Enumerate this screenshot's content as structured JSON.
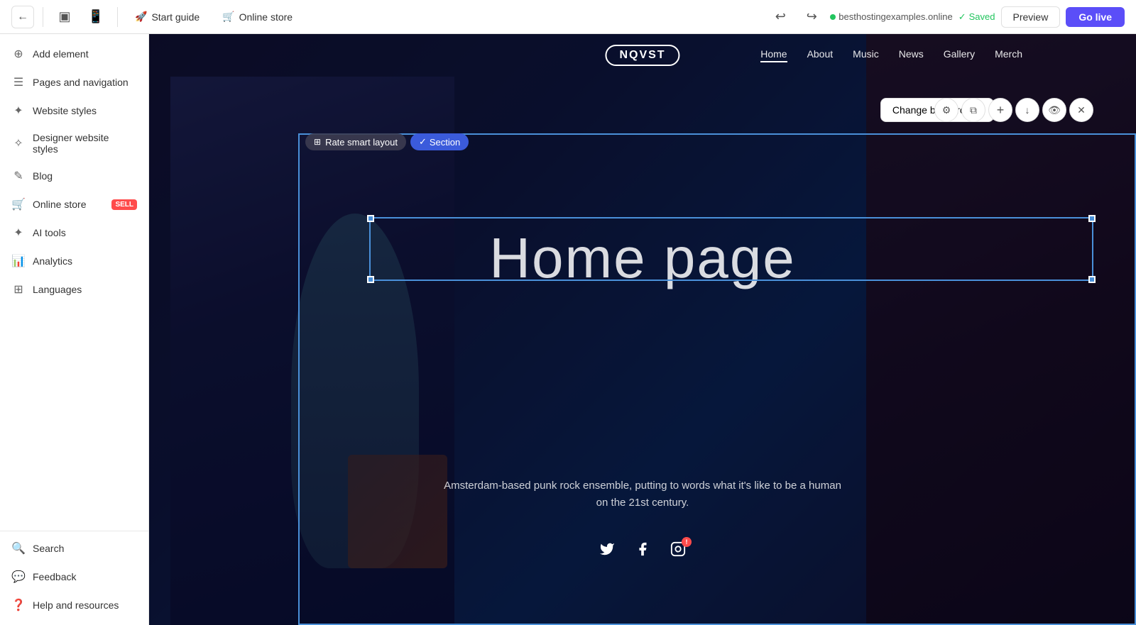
{
  "topbar": {
    "back_icon": "←",
    "desktop_icon": "⬜",
    "start_guide_label": "Start guide",
    "start_guide_icon": "🚀",
    "online_store_label": "Online store",
    "online_store_icon": "🛒",
    "mobile_icon": "📱",
    "undo_icon": "↩",
    "redo_icon": "↪",
    "domain": "besthostingexamples.online",
    "saved_label": "Saved",
    "preview_label": "Preview",
    "golive_label": "Go live"
  },
  "sidebar": {
    "items": [
      {
        "id": "add-element",
        "label": "Add element",
        "icon": "⊕"
      },
      {
        "id": "pages-navigation",
        "label": "Pages and navigation",
        "icon": "☰"
      },
      {
        "id": "website-styles",
        "label": "Website styles",
        "icon": "✦"
      },
      {
        "id": "designer-styles",
        "label": "Designer website styles",
        "icon": "✧"
      },
      {
        "id": "blog",
        "label": "Blog",
        "icon": "✎"
      },
      {
        "id": "online-store",
        "label": "Online store",
        "icon": "🛒",
        "badge": "SELL"
      },
      {
        "id": "ai-tools",
        "label": "AI tools",
        "icon": "✦"
      },
      {
        "id": "analytics",
        "label": "Analytics",
        "icon": "📊"
      },
      {
        "id": "languages",
        "label": "Languages",
        "icon": "⊞"
      }
    ],
    "bottom_items": [
      {
        "id": "search",
        "label": "Search",
        "icon": "🔍"
      },
      {
        "id": "feedback",
        "label": "Feedback",
        "icon": "💬"
      },
      {
        "id": "help",
        "label": "Help and resources",
        "icon": "❓"
      }
    ]
  },
  "site": {
    "logo": "NQVST",
    "nav_links": [
      "Home",
      "About",
      "Music",
      "News",
      "Gallery",
      "Merch"
    ],
    "active_nav": "Home",
    "home_title": "Home page",
    "subtitle_line1": "Amsterdam-based punk rock ensemble, putting to words what it's like to be a human",
    "subtitle_line2": "on the 21st century.",
    "change_bg_label": "Change background",
    "rate_layout_label": "Rate smart layout",
    "section_label": "Section"
  },
  "toolbar_icons": {
    "settings": "⚙",
    "copy": "⧉",
    "add": "+",
    "move_down": "↓",
    "preview": "👁",
    "delete": "✕"
  },
  "colors": {
    "accent": "#5b4ef8",
    "selection_blue": "#4a90d9",
    "section_badge": "#3b5bdb",
    "sell_badge": "#ff4b4b",
    "notification": "#ff4b4b",
    "saved_green": "#22c55e"
  }
}
